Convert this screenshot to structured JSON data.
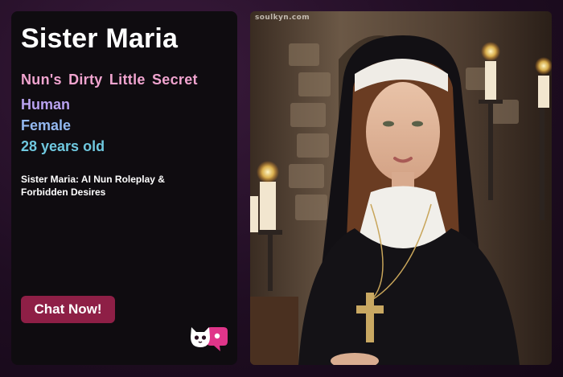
{
  "character": {
    "name": "Sister Maria",
    "tagline": "Nun's Dirty Little Secret",
    "species": "Human",
    "gender": "Female",
    "age": "28 years old",
    "description": "Sister Maria: AI Nun Roleplay & Forbidden Desires"
  },
  "actions": {
    "chat_label": "Chat Now!"
  },
  "image": {
    "watermark": "soulkyn.com",
    "logo_icon": "cat-face-chat-bubble-icon"
  },
  "colors": {
    "accent_button": "#8e1f46",
    "tagline": "#f0a4cf",
    "species": "#b9a2f0",
    "gender": "#93b8f0",
    "age": "#6fc8df"
  }
}
